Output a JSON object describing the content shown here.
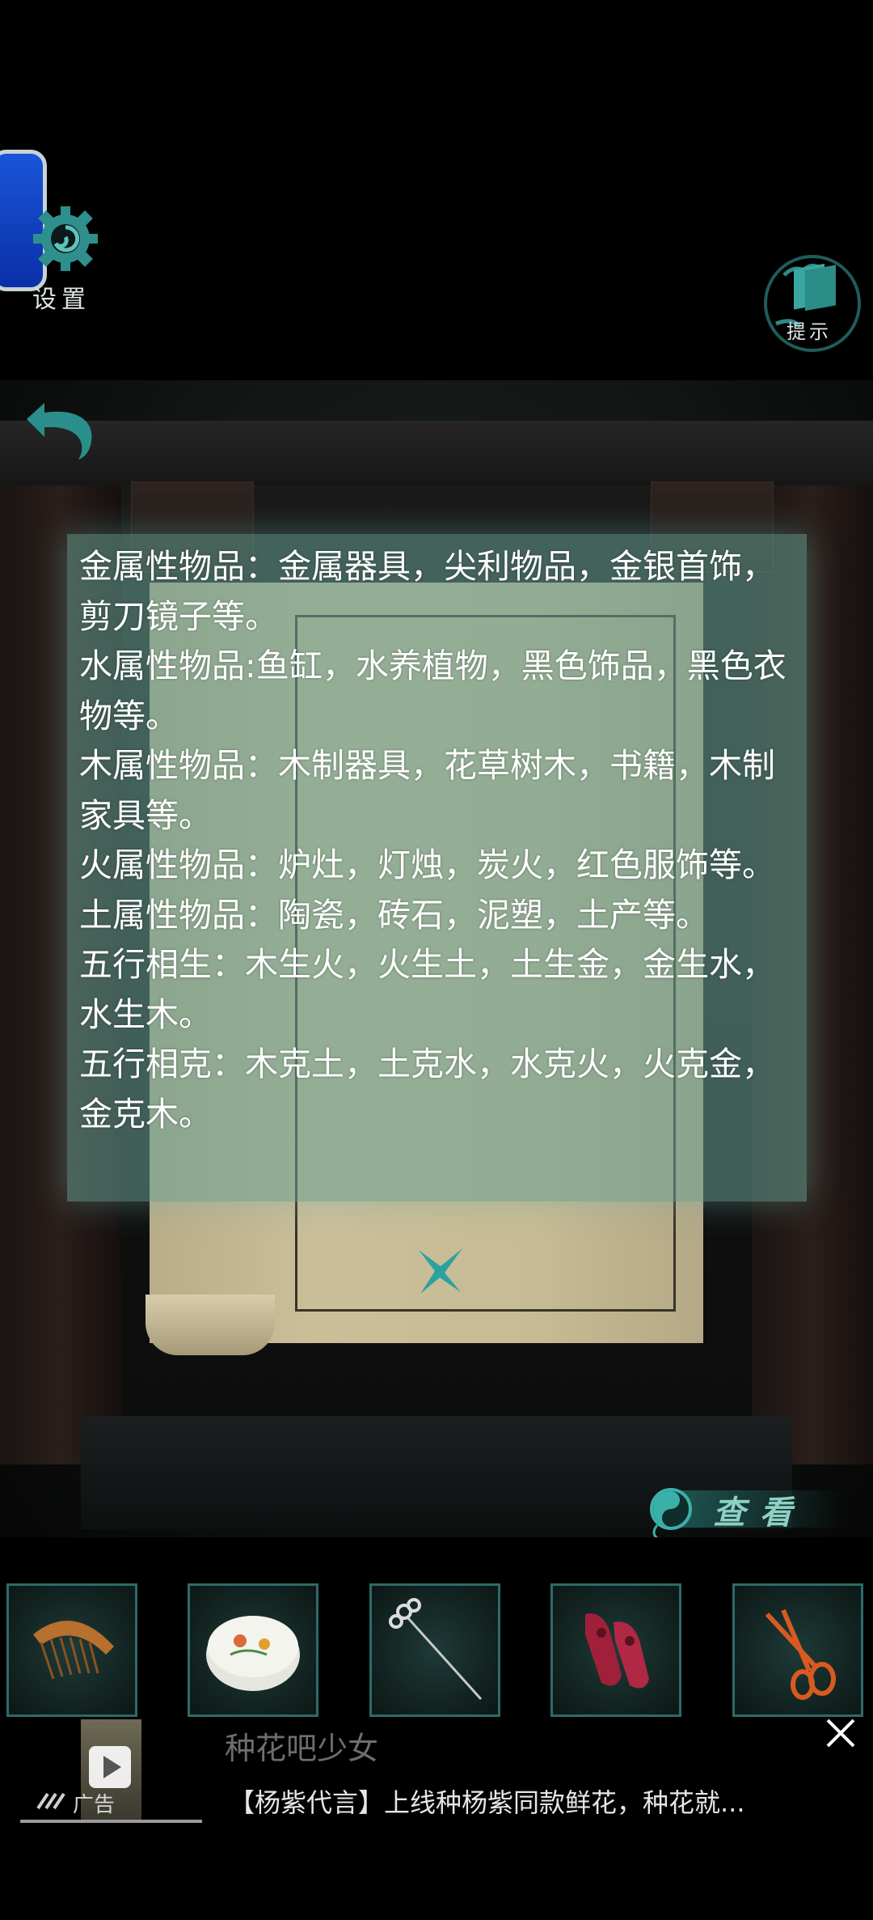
{
  "top_bar": {
    "settings_label": "设置",
    "hint_label": "提示"
  },
  "info_panel": {
    "lines": [
      "金属性物品：金属器具，尖利物品，金银首饰，剪刀镜子等。",
      "水属性物品:鱼缸，水养植物，黑色饰品，黑色衣物等。",
      "木属性物品：木制器具，花草树木，书籍，木制家具等。",
      "火属性物品：炉灶，灯烛，炭火，红色服饰等。",
      "土属性物品：陶瓷，砖石，泥塑，土产等。",
      "五行相生：木生火，火生土，土生金，金生水，水生木。",
      "五行相克：木克土，土克水，水克火，火克金，金克木。"
    ]
  },
  "view_button": {
    "label": "查看"
  },
  "inventory": [
    {
      "name": "comb-item"
    },
    {
      "name": "porcelain-box-item"
    },
    {
      "name": "hairpin-item"
    },
    {
      "name": "red-shoes-item"
    },
    {
      "name": "scissors-item"
    }
  ],
  "ad": {
    "title": "种花吧少女",
    "description": "【杨紫代言】上线种杨紫同款鲜花，种花就...",
    "tag": "广告"
  },
  "colors": {
    "panel": "#67a094",
    "accent": "#8dd0c4",
    "inventory_border": "#2c6b68"
  }
}
